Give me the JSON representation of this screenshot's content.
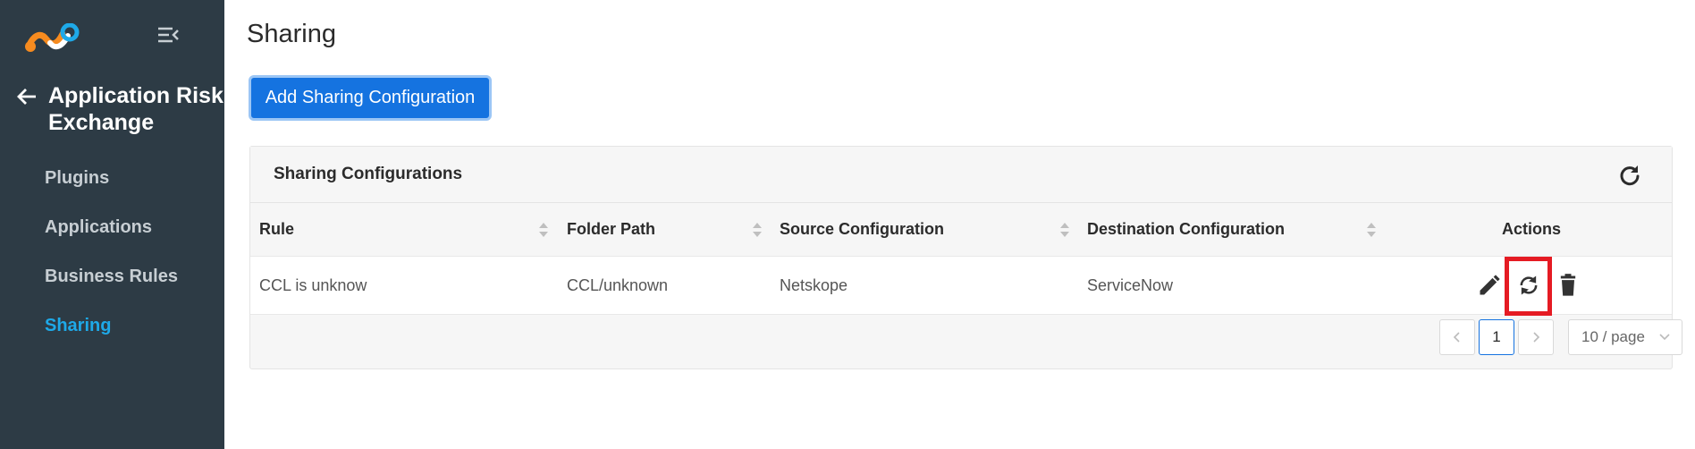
{
  "sidebar": {
    "app_title": "Application Risk Exchange",
    "items": [
      {
        "label": "Plugins",
        "active": false
      },
      {
        "label": "Applications",
        "active": false
      },
      {
        "label": "Business Rules",
        "active": false
      },
      {
        "label": "Sharing",
        "active": true
      }
    ],
    "colors": {
      "background": "#2d3b45",
      "active": "#1ea9e8",
      "logo_orange": "#f68b1f",
      "logo_blue": "#1ea9e8"
    }
  },
  "main": {
    "page_title": "Sharing",
    "add_button_label": "Add Sharing Configuration",
    "card": {
      "title": "Sharing Configurations",
      "columns": [
        "Rule",
        "Folder Path",
        "Source Configuration",
        "Destination Configuration",
        "Actions"
      ],
      "rows": [
        {
          "rule": "CCL is unknow",
          "folder_path": "CCL/unknown",
          "source": "Netskope",
          "destination": "ServiceNow"
        }
      ],
      "actions": [
        "edit-icon",
        "sync-icon",
        "delete-icon"
      ]
    },
    "pagination": {
      "current_page": "1",
      "page_size": "10 / page"
    },
    "colors": {
      "primary": "#1573e0",
      "highlight": "#e51b23"
    }
  }
}
